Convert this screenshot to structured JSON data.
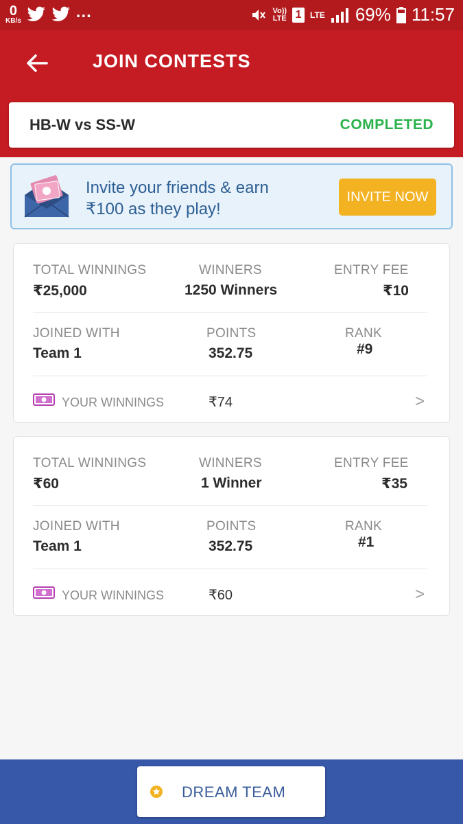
{
  "status_bar": {
    "net_speed_value": "0",
    "net_speed_unit": "KB/s",
    "volte_top": "Vo))",
    "volte_bottom": "LTE",
    "sim_slot": "1",
    "lte": "LTE",
    "battery": "69%",
    "time": "11:57"
  },
  "header": {
    "title": "JOIN CONTESTS",
    "match": "HB-W vs SS-W",
    "match_status": "COMPLETED"
  },
  "invite": {
    "line1": "Invite your friends & earn",
    "line2": "₹100 as they play!",
    "button": "INVITE NOW"
  },
  "contests": [
    {
      "total_winnings_label": "TOTAL WINNINGS",
      "total_winnings": "₹25,000",
      "winners_label": "WINNERS",
      "winners": "1250 Winners",
      "entry_fee_label": "ENTRY FEE",
      "entry_fee": "₹10",
      "joined_with_label": "JOINED WITH",
      "joined_with": "Team  1",
      "points_label": "POINTS",
      "points": "352.75",
      "rank_label": "RANK",
      "rank": "#9",
      "your_winnings_label": "YOUR WINNINGS",
      "your_winnings": "₹74"
    },
    {
      "total_winnings_label": "TOTAL WINNINGS",
      "total_winnings": "₹60",
      "winners_label": "WINNERS",
      "winners": "1 Winner",
      "entry_fee_label": "ENTRY FEE",
      "entry_fee": "₹35",
      "joined_with_label": "JOINED WITH",
      "joined_with": "Team  1",
      "points_label": "POINTS",
      "points": "352.75",
      "rank_label": "RANK",
      "rank": "#1",
      "your_winnings_label": "YOUR WINNINGS",
      "your_winnings": "₹60"
    }
  ],
  "bottom": {
    "dream_team": "DREAM TEAM"
  },
  "colors": {
    "header_red": "#c51b22",
    "status_green": "#2bb24c",
    "invite_orange": "#f3b222",
    "bottom_blue": "#3758a8"
  }
}
